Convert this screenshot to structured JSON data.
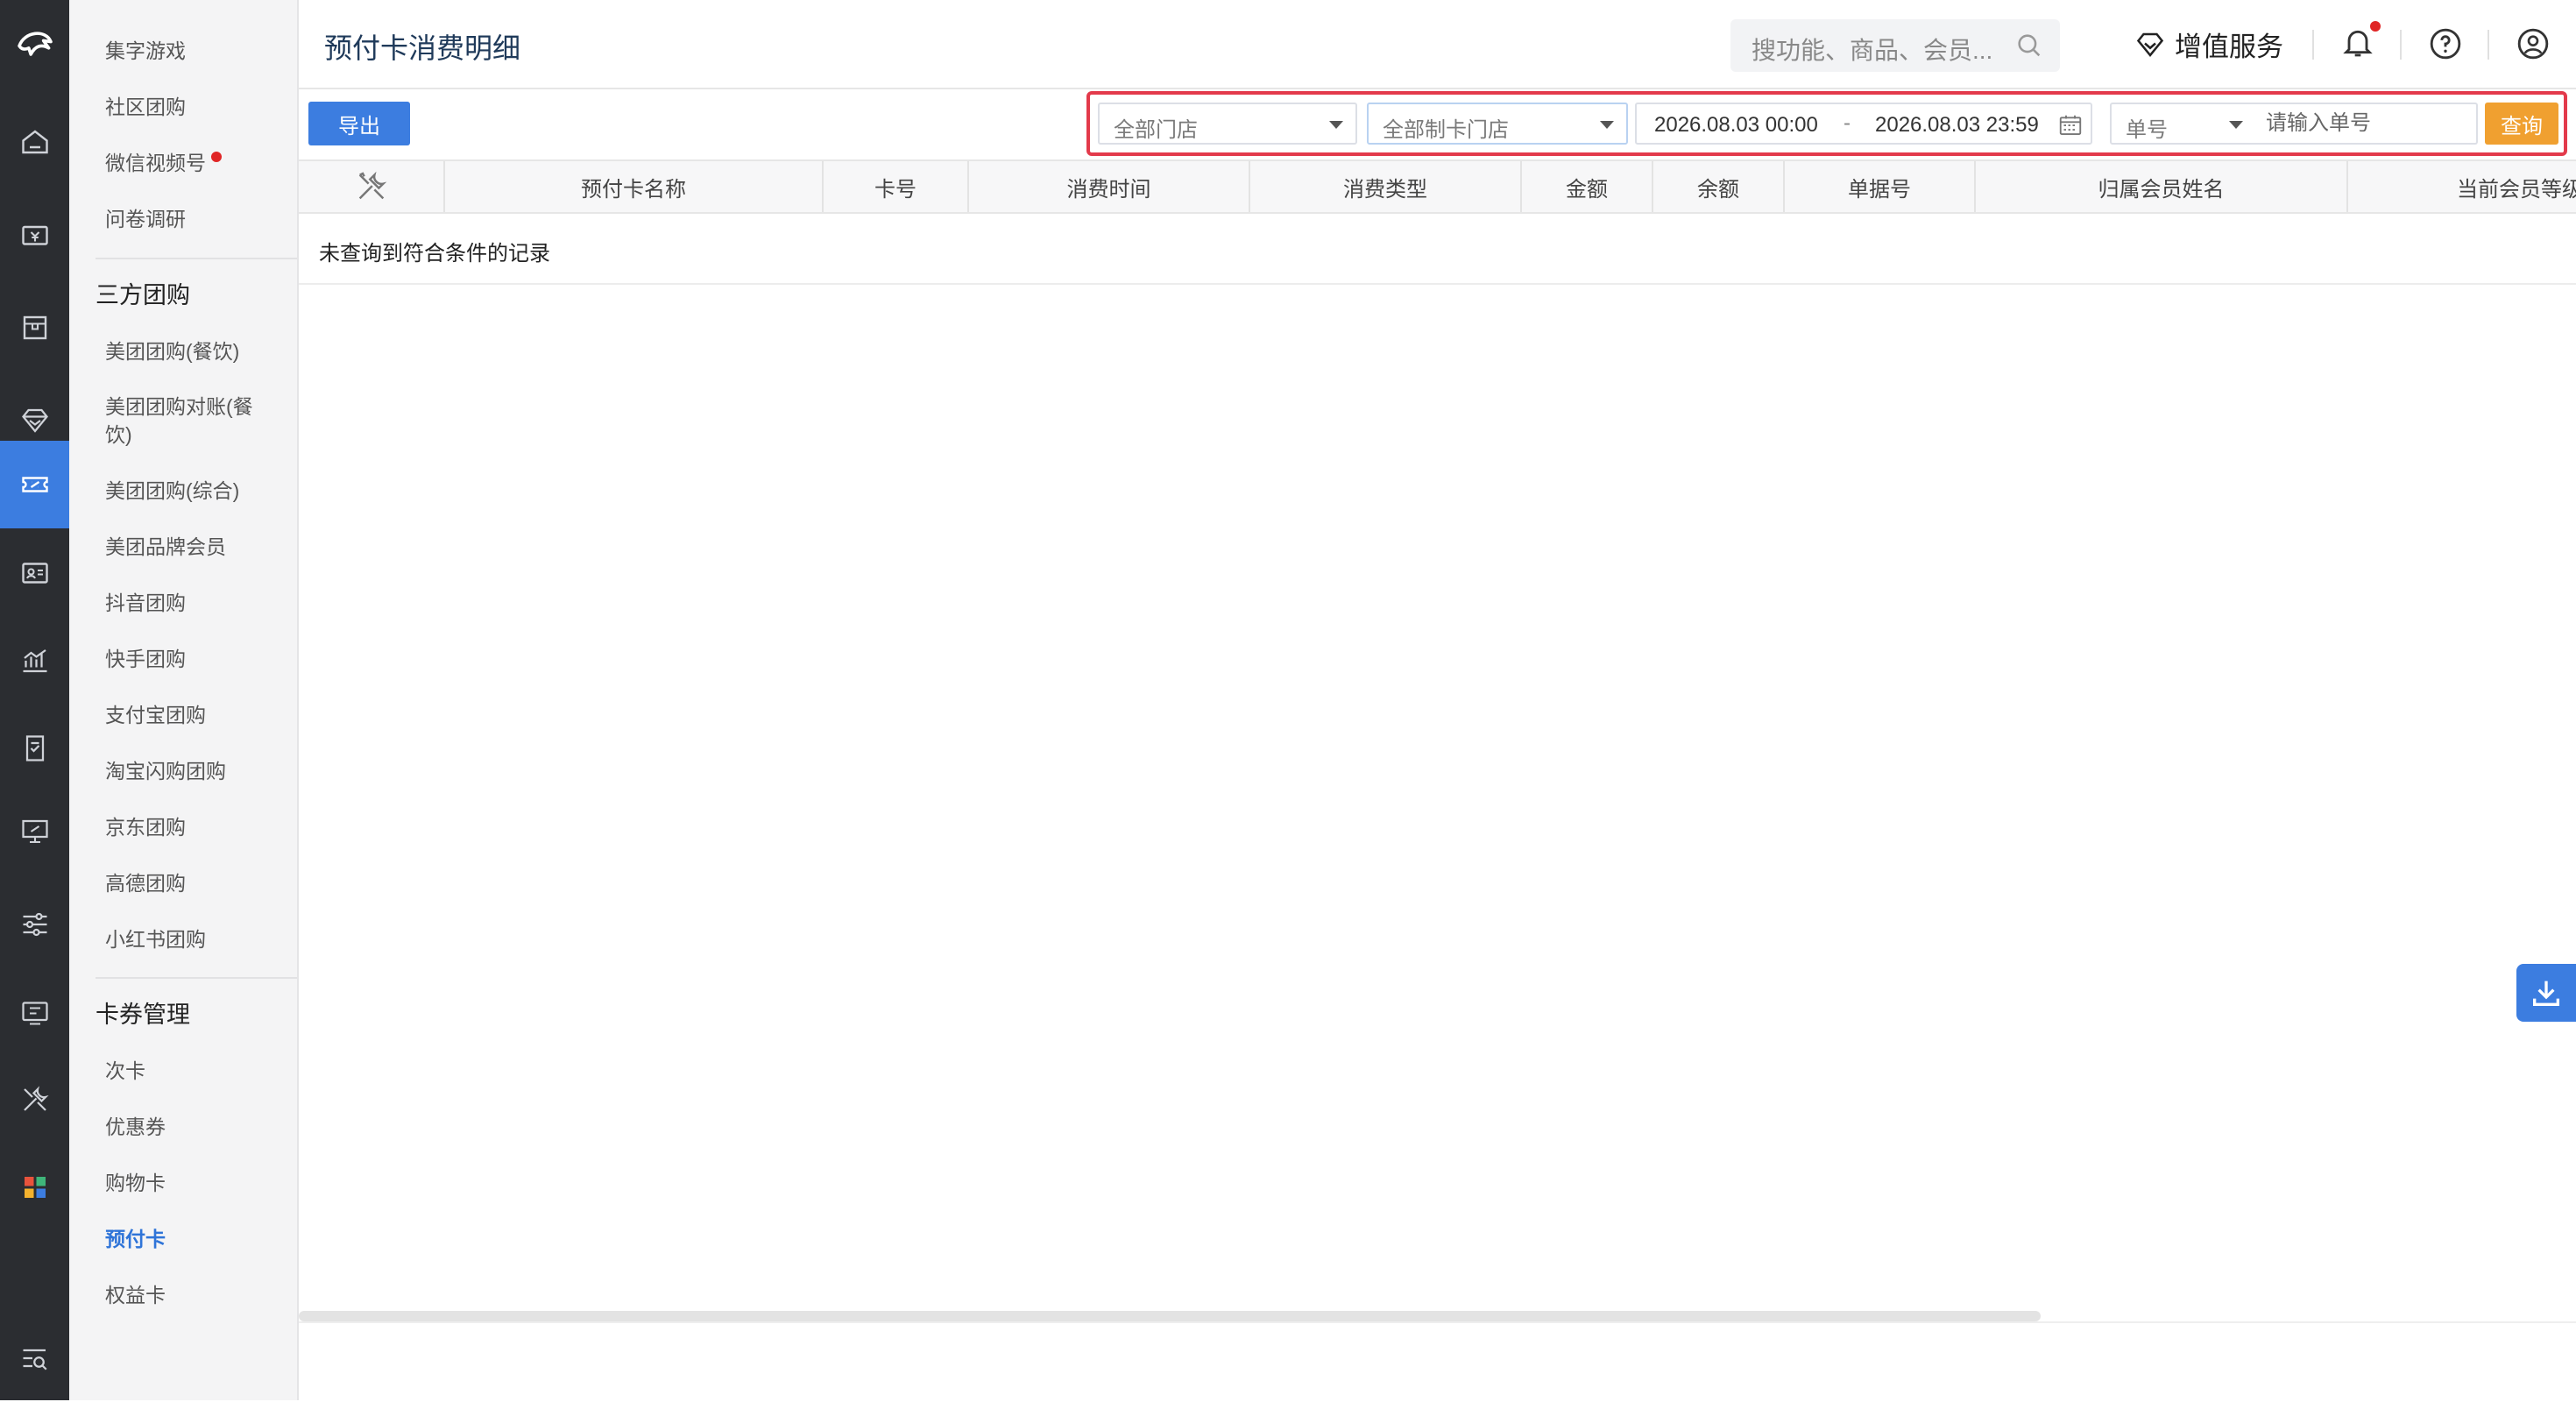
{
  "app": {
    "title": "预付卡消费明细"
  },
  "header": {
    "search_placeholder": "搜功能、商品、会员...",
    "value_added_label": "增值服务"
  },
  "sidebar": {
    "items_top": [
      "集字游戏",
      "社区团购",
      "微信视频号",
      "问卷调研"
    ],
    "section_group": {
      "title": "三方团购",
      "items": [
        "美团团购(餐饮)",
        "美团团购对账(餐饮)",
        "美团团购(综合)",
        "美团品牌会员",
        "抖音团购",
        "快手团购",
        "支付宝团购",
        "淘宝闪购团购",
        "京东团购",
        "高德团购",
        "小红书团购"
      ]
    },
    "section_cards": {
      "title": "卡券管理",
      "items": [
        "次卡",
        "优惠券",
        "购物卡",
        "预付卡",
        "权益卡"
      ]
    },
    "active_item": "预付卡"
  },
  "toolbar": {
    "export_label": "导出",
    "store_select": "全部门店",
    "card_store_select": "全部制卡门店",
    "date_start": "2026.08.03 00:00",
    "date_sep": "-",
    "date_end": "2026.08.03 23:59",
    "field_select": "单号",
    "order_placeholder": "请输入单号",
    "query_label": "查询"
  },
  "table": {
    "columns": [
      "预付卡名称",
      "卡号",
      "消费时间",
      "消费类型",
      "金额",
      "余额",
      "单据号",
      "归属会员姓名",
      "当前会员等级"
    ],
    "empty_text": "未查询到符合条件的记录"
  },
  "colors": {
    "accent": "#3c7de0",
    "query": "#f0a030",
    "highlight_border": "#e33a4b",
    "rail": "#2b2d31"
  }
}
